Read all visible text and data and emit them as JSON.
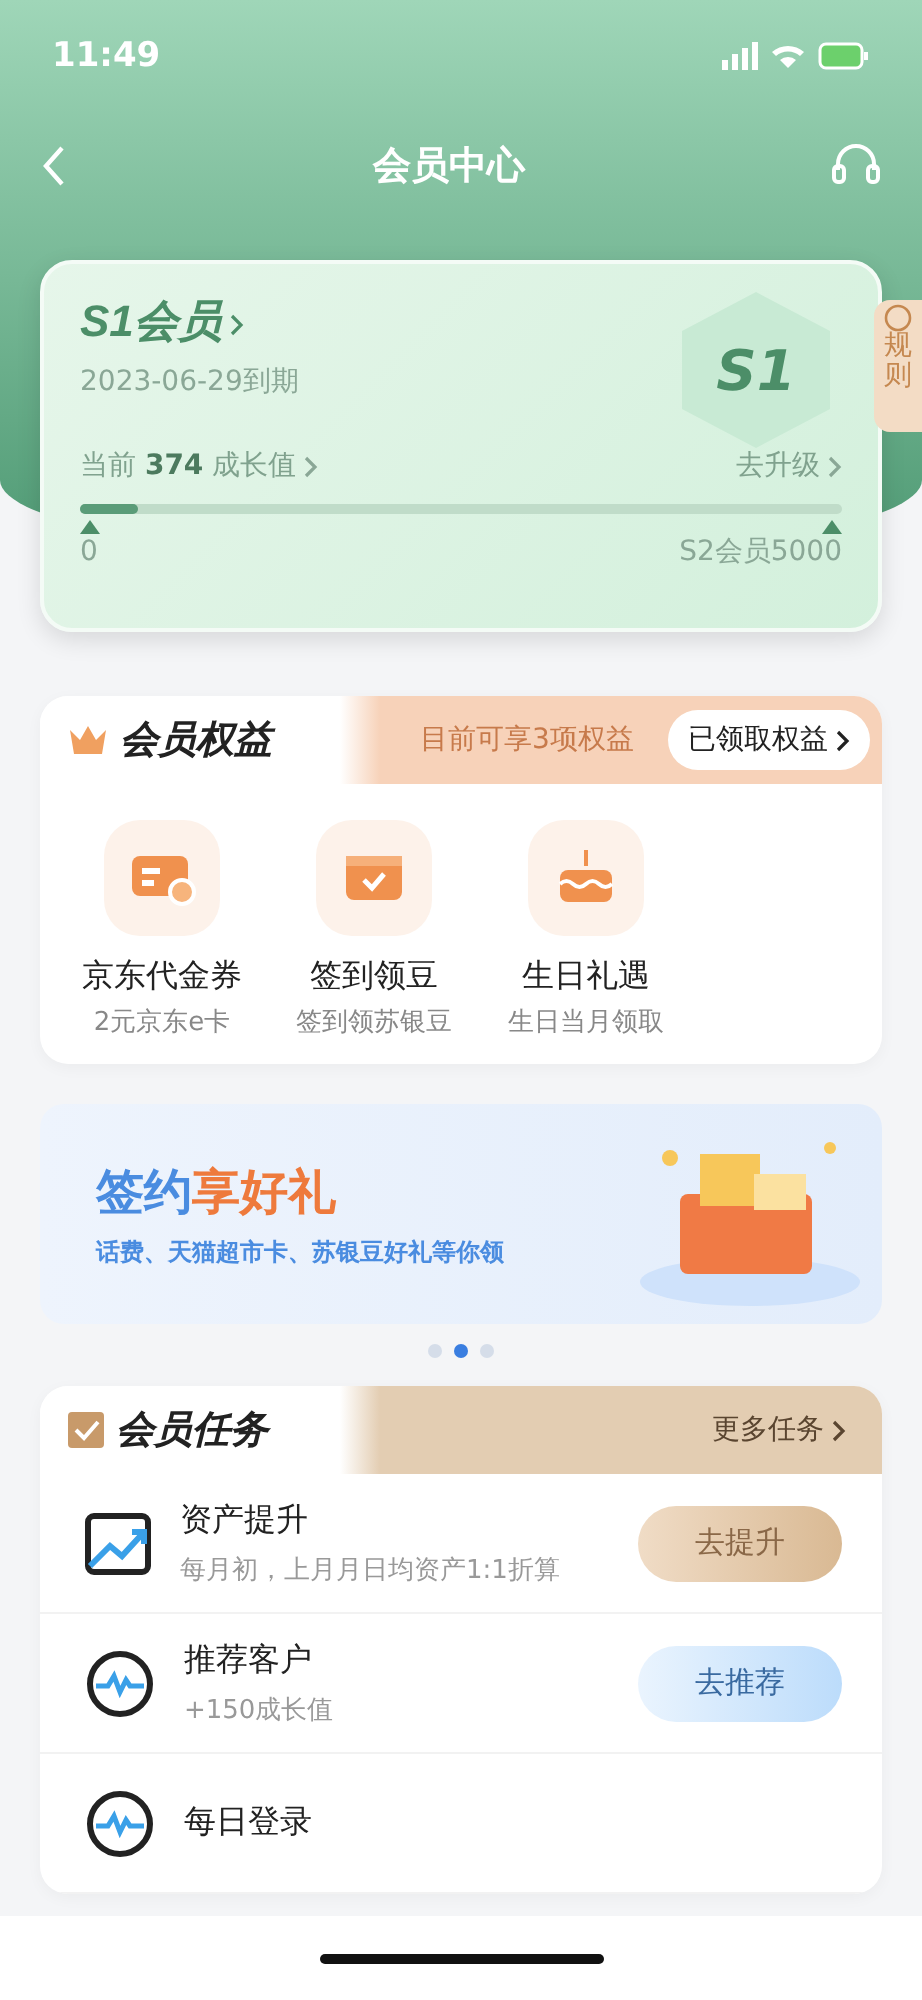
{
  "status_bar": {
    "time": "11:49"
  },
  "nav": {
    "title": "会员中心"
  },
  "member_card": {
    "level_name": "S1会员",
    "expiry": "2023-06-29到期",
    "badge": "S1",
    "growth_prefix": "当前",
    "growth_value": "374",
    "growth_suffix": "成长值",
    "upgrade": "去升级",
    "progress": {
      "level": 0.075
    },
    "start_label": "0",
    "end_label": "S2会员5000"
  },
  "rules_tab": {
    "label": "规则"
  },
  "benefits": {
    "title": "会员权益",
    "summary": "目前可享3项权益",
    "claimed_button": "已领取权益",
    "items": [
      {
        "kind": "voucher",
        "name": "京东代金券",
        "desc": "2元京东e卡"
      },
      {
        "kind": "checkin",
        "name": "签到领豆",
        "desc": "签到领苏银豆"
      },
      {
        "kind": "cake",
        "name": "生日礼遇",
        "desc": "生日当月领取"
      }
    ]
  },
  "banner": {
    "title_part1": "签约",
    "title_part2": "享好礼",
    "subtitle": "话费、天猫超市卡、苏银豆好礼等你领",
    "dots": [
      {
        "selected": false
      },
      {
        "selected": true
      },
      {
        "selected": false
      }
    ]
  },
  "tasks": {
    "title": "会员任务",
    "more": "更多任务",
    "items": [
      {
        "kind": "chart",
        "name": "资产提升",
        "desc": "每月初，上月月日均资产1:1折算",
        "button": {
          "label": "去提升",
          "kind": "gold"
        }
      },
      {
        "kind": "pulse",
        "name": "推荐客户",
        "desc": "+150成长值",
        "button": {
          "label": "去推荐",
          "kind": "blue"
        }
      },
      {
        "kind": "pulse",
        "name": "每日登录"
      }
    ]
  }
}
